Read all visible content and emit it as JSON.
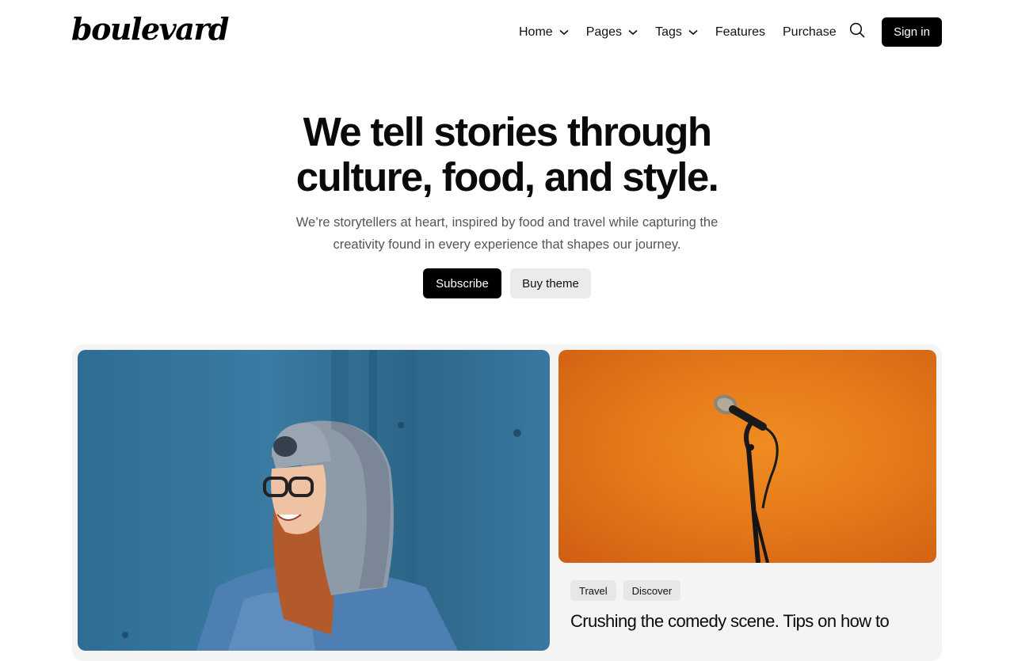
{
  "header": {
    "logo": "boulevard",
    "nav": [
      {
        "label": "Home",
        "has_dropdown": true
      },
      {
        "label": "Pages",
        "has_dropdown": true
      },
      {
        "label": "Tags",
        "has_dropdown": true
      },
      {
        "label": "Features",
        "has_dropdown": false
      },
      {
        "label": "Purchase",
        "has_dropdown": false
      }
    ],
    "search_icon": "search-icon",
    "signin_label": "Sign in"
  },
  "hero": {
    "title_line1": "We tell stories through",
    "title_line2": "culture, food, and style.",
    "subtitle_line1": "We’re storytellers at heart, inspired by food and travel while capturing the",
    "subtitle_line2": "creativity found in every experience that shapes our journey.",
    "subscribe_label": "Subscribe",
    "buy_label": "Buy theme"
  },
  "featured": {
    "right_card": {
      "tags": [
        "Travel",
        "Discover"
      ],
      "title": "Crushing the comedy scene. Tips on how to"
    }
  },
  "colors": {
    "primary": "#000000",
    "secondary_button": "#ebebeb",
    "card_bg": "#f4f4f4",
    "blue_photo": "#2f6d93",
    "orange_photo": "#ef8c21"
  }
}
